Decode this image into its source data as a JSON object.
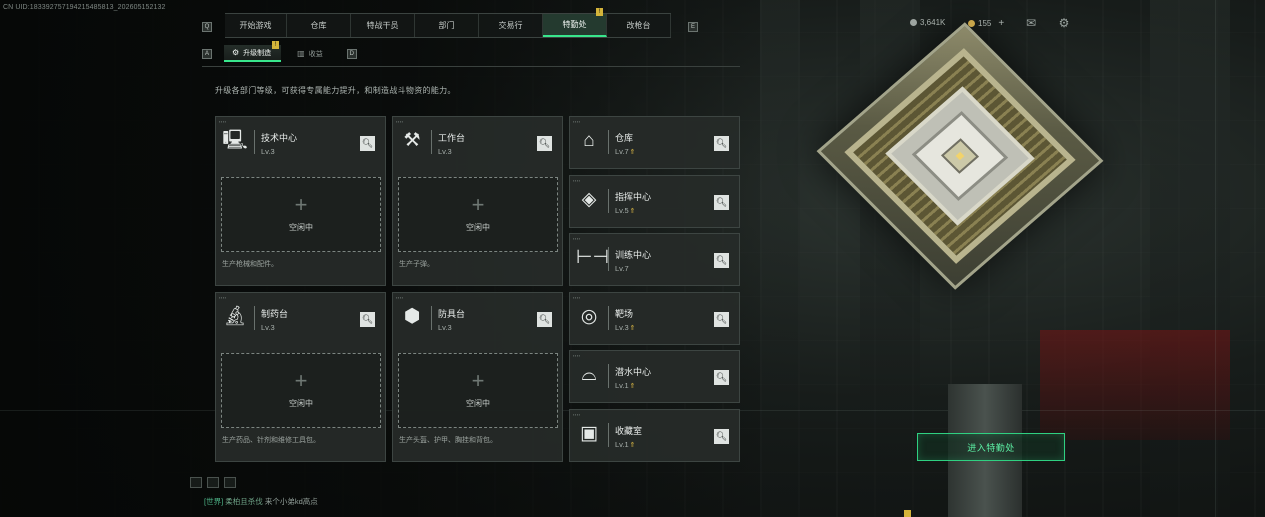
{
  "session_uid": "CN UID:183392757194215485813_202605152132",
  "nav": {
    "left_key": "Q",
    "right_key": "E",
    "tabs": [
      {
        "label": "开始游戏",
        "active": false
      },
      {
        "label": "仓库",
        "active": false
      },
      {
        "label": "特战干员",
        "active": false
      },
      {
        "label": "部门",
        "active": false
      },
      {
        "label": "交易行",
        "active": false
      },
      {
        "label": "特勤处",
        "active": true,
        "badge": "!"
      },
      {
        "label": "改枪台",
        "active": false
      }
    ]
  },
  "resources": {
    "currency_1": "3,641K",
    "currency_2": "155",
    "add": "+"
  },
  "subnav": {
    "left_key": "A",
    "right_key": "D",
    "tabs": [
      {
        "label": "升级制造",
        "active": true,
        "badge": "!"
      },
      {
        "label": "收益",
        "active": false
      }
    ]
  },
  "description": "升级各部门等级，可获得专属能力提升，和制造战斗物资的能力。",
  "production_facilities": [
    {
      "name": "技术中心",
      "level": "Lv.3",
      "icon": "computer-icon",
      "slot_status": "空闲中",
      "note": "生产枪械和配件。"
    },
    {
      "name": "工作台",
      "level": "Lv.3",
      "icon": "tools-icon",
      "slot_status": "空闲中",
      "note": "生产子弹。"
    },
    {
      "name": "制药台",
      "level": "Lv.3",
      "icon": "microscope-icon",
      "slot_status": "空闲中",
      "note": "生产药品、针剂和维修工具包。"
    },
    {
      "name": "防具台",
      "level": "Lv.3",
      "icon": "armor-materials-icon",
      "slot_status": "空闲中",
      "note": "生产头盔、护甲、胸挂和背包。"
    }
  ],
  "upgrade_facilities": [
    {
      "name": "仓库",
      "level": "Lv.7",
      "upgradable": true,
      "icon": "warehouse-icon"
    },
    {
      "name": "指挥中心",
      "level": "Lv.5",
      "upgradable": true,
      "icon": "command-center-icon"
    },
    {
      "name": "训练中心",
      "level": "Lv.7",
      "upgradable": false,
      "icon": "dumbbell-icon"
    },
    {
      "name": "靶场",
      "level": "Lv.3",
      "upgradable": true,
      "icon": "target-icon"
    },
    {
      "name": "潜水中心",
      "level": "Lv.1",
      "upgradable": true,
      "icon": "diving-goggles-icon"
    },
    {
      "name": "收藏室",
      "level": "Lv.1",
      "upgradable": true,
      "icon": "collection-icon"
    }
  ],
  "enter_button": "进入特勤处",
  "chat": {
    "channel": "[世界]",
    "sender": "柔柏且杀伐",
    "message": "来个小弟kd高点"
  },
  "colors": {
    "accent_green": "#38e68c",
    "badge_yellow": "#d4b43a",
    "upgrade_arrow": "#d7b544"
  }
}
